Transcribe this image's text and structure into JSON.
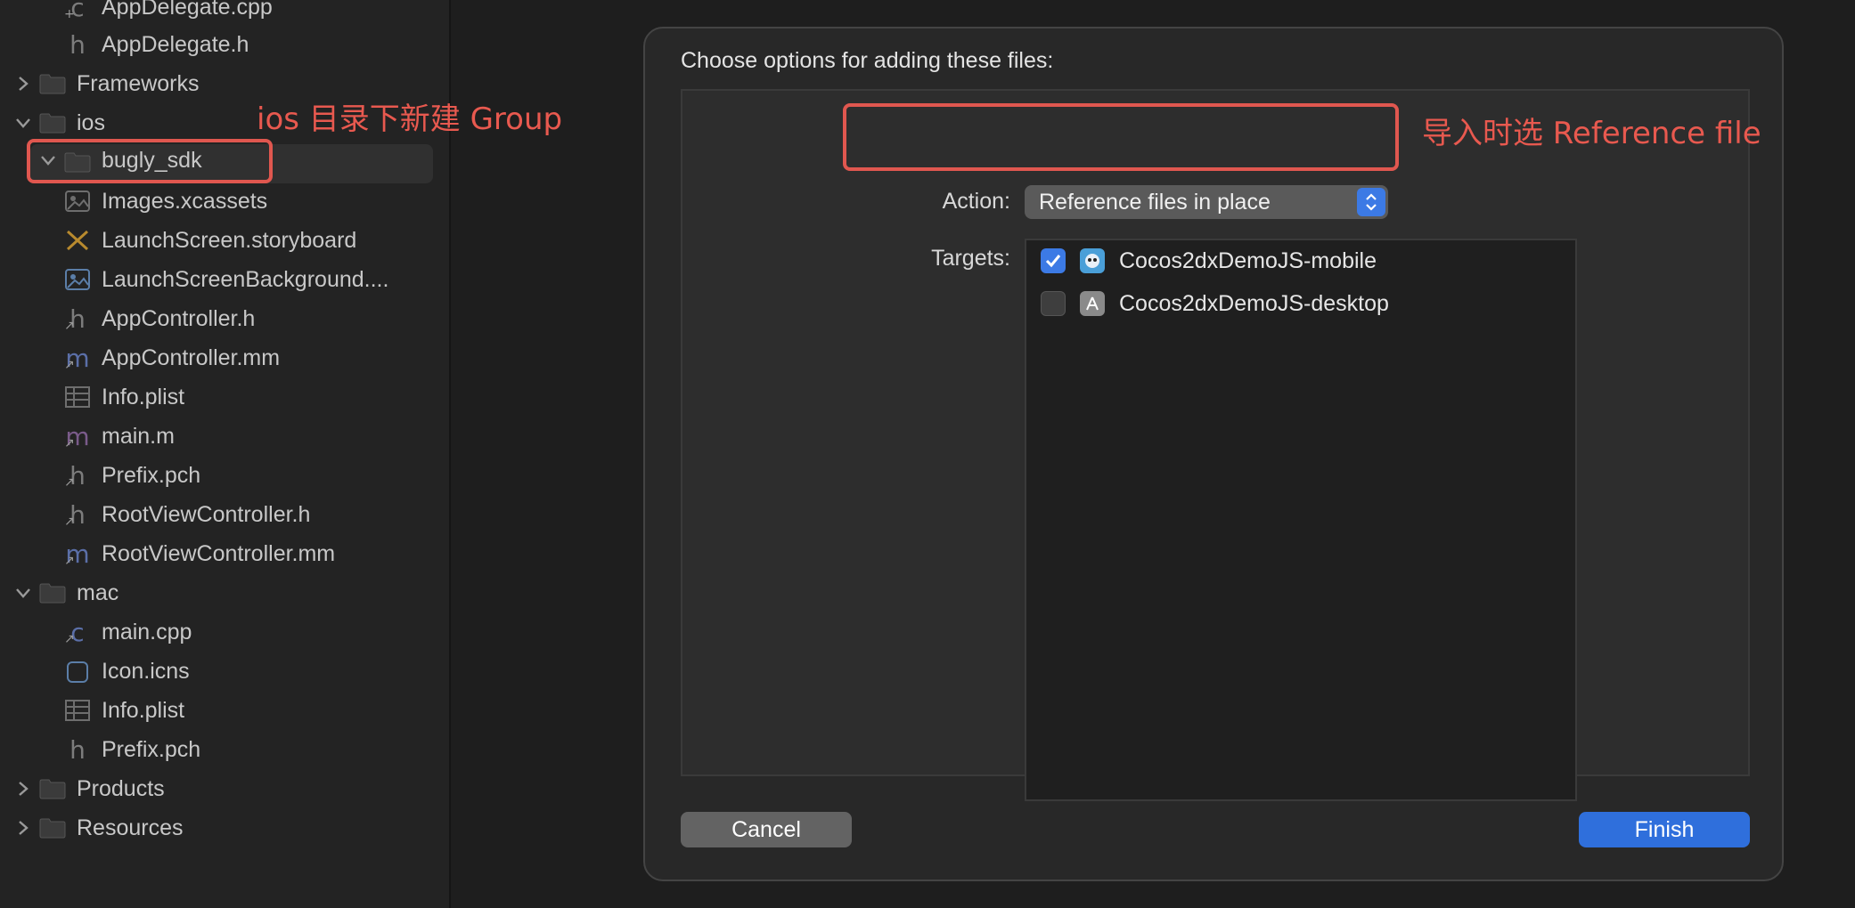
{
  "navigator": {
    "items": [
      {
        "label": "AppDelegate.cpp",
        "icon": "c"
      },
      {
        "label": "AppDelegate.h",
        "icon": "h"
      },
      {
        "label": "Frameworks",
        "icon": "folder"
      },
      {
        "label": "ios",
        "icon": "folder"
      },
      {
        "label": "bugly_sdk",
        "icon": "folder"
      },
      {
        "label": "Images.xcassets",
        "icon": "image"
      },
      {
        "label": "LaunchScreen.storyboard",
        "icon": "storyboard"
      },
      {
        "label": "LaunchScreenBackground....",
        "icon": "image"
      },
      {
        "label": "AppController.h",
        "icon": "h"
      },
      {
        "label": "AppController.mm",
        "icon": "m"
      },
      {
        "label": "Info.plist",
        "icon": "plist"
      },
      {
        "label": "main.m",
        "icon": "m"
      },
      {
        "label": "Prefix.pch",
        "icon": "h"
      },
      {
        "label": "RootViewController.h",
        "icon": "h"
      },
      {
        "label": "RootViewController.mm",
        "icon": "m"
      },
      {
        "label": "mac",
        "icon": "folder"
      },
      {
        "label": "main.cpp",
        "icon": "c"
      },
      {
        "label": "Icon.icns",
        "icon": "icns"
      },
      {
        "label": "Info.plist",
        "icon": "plist"
      },
      {
        "label": "Prefix.pch",
        "icon": "h"
      },
      {
        "label": "Products",
        "icon": "folder"
      },
      {
        "label": "Resources",
        "icon": "folder"
      }
    ]
  },
  "annotations": {
    "group_note": "ios 目录下新建 Group",
    "action_note": "导入时选 Reference file"
  },
  "dialog": {
    "title": "Choose options for adding these files:",
    "action_label": "Action:",
    "action_value": "Reference files in place",
    "targets_label": "Targets:",
    "targets": [
      {
        "name": "Cocos2dxDemoJS-mobile",
        "checked": true
      },
      {
        "name": "Cocos2dxDemoJS-desktop",
        "checked": false
      }
    ],
    "cancel_label": "Cancel",
    "finish_label": "Finish"
  },
  "colors": {
    "accent": "#3c7ae5",
    "annotation": "#e0574f"
  }
}
